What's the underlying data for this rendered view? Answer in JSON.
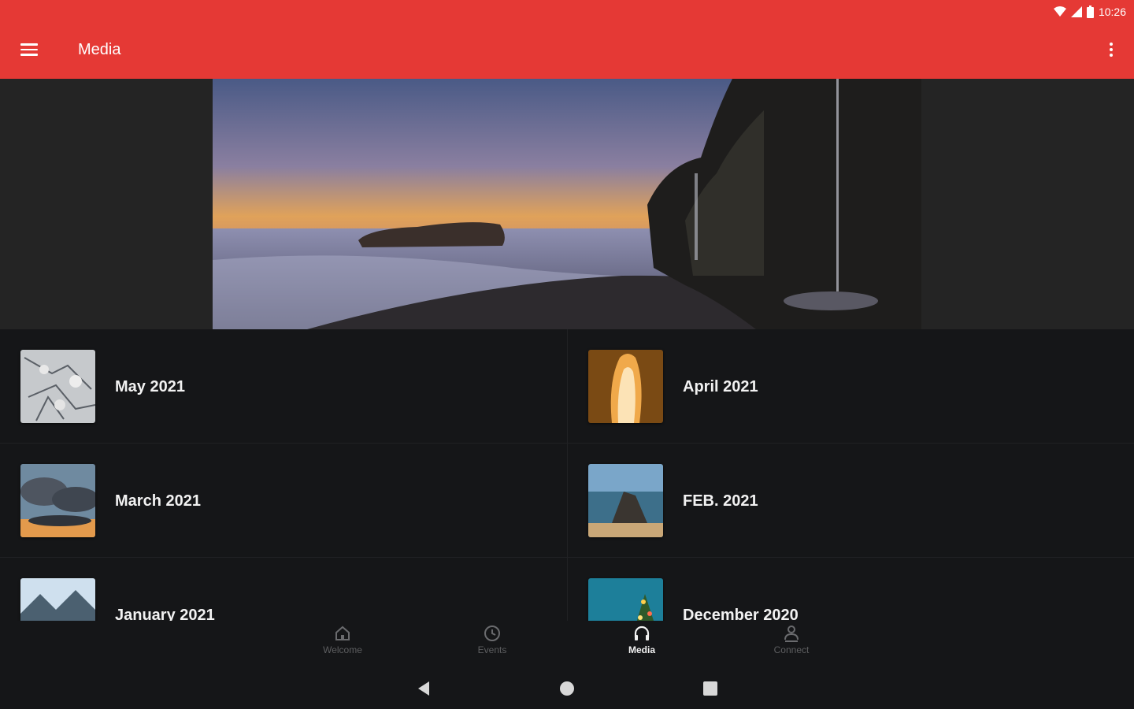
{
  "status_bar": {
    "time": "10:26"
  },
  "app_bar": {
    "title": "Media"
  },
  "media_items": [
    {
      "label": "May 2021"
    },
    {
      "label": "April 2021"
    },
    {
      "label": "March 2021"
    },
    {
      "label": "FEB. 2021"
    },
    {
      "label": "January 2021"
    },
    {
      "label": "December 2020"
    }
  ],
  "bottom_nav": {
    "items": [
      {
        "label": "Welcome",
        "icon": "home-icon"
      },
      {
        "label": "Events",
        "icon": "clock-icon"
      },
      {
        "label": "Media",
        "icon": "headphones-icon",
        "active": true
      },
      {
        "label": "Connect",
        "icon": "people-icon"
      }
    ]
  },
  "colors": {
    "app_bar": "#e53935",
    "background": "#151618",
    "hero_bg": "#242424"
  }
}
